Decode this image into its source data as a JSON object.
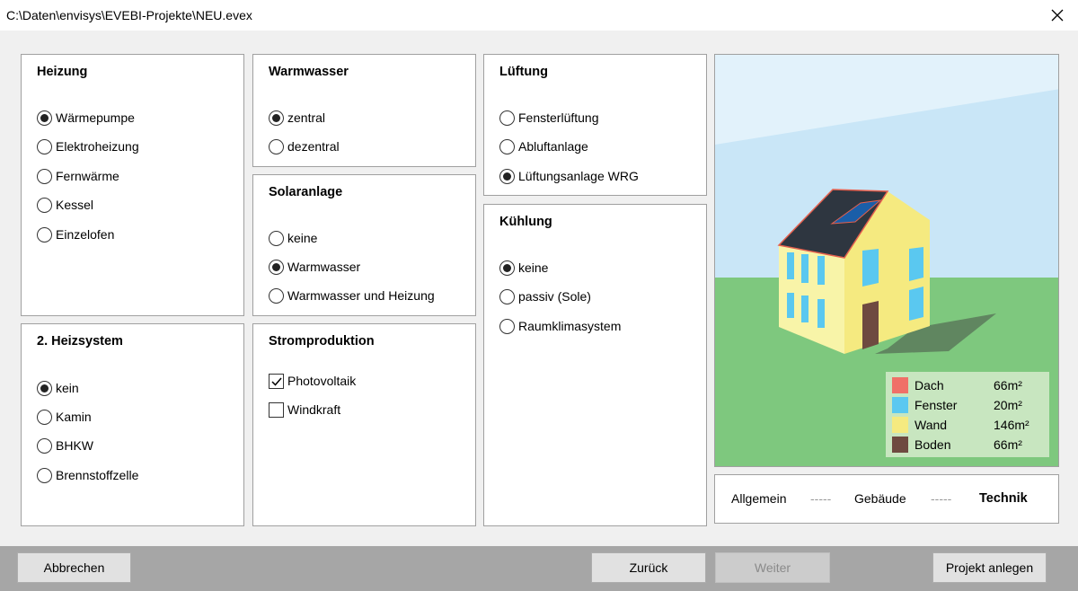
{
  "window": {
    "title": "C:\\Daten\\envisys\\EVEBI-Projekte\\NEU.evex"
  },
  "panels": {
    "heizung": {
      "title": "Heizung",
      "options": [
        {
          "label": "Wärmepumpe",
          "selected": true
        },
        {
          "label": "Elektroheizung",
          "selected": false
        },
        {
          "label": "Fernwärme",
          "selected": false
        },
        {
          "label": "Kessel",
          "selected": false
        },
        {
          "label": "Einzelofen",
          "selected": false
        }
      ]
    },
    "heizsystem2": {
      "title": "2. Heizsystem",
      "options": [
        {
          "label": "kein",
          "selected": true
        },
        {
          "label": "Kamin",
          "selected": false
        },
        {
          "label": "BHKW",
          "selected": false
        },
        {
          "label": "Brennstoffzelle",
          "selected": false
        }
      ]
    },
    "warmwasser": {
      "title": "Warmwasser",
      "options": [
        {
          "label": "zentral",
          "selected": true
        },
        {
          "label": "dezentral",
          "selected": false
        }
      ]
    },
    "solaranlage": {
      "title": "Solaranlage",
      "options": [
        {
          "label": "keine",
          "selected": false
        },
        {
          "label": "Warmwasser",
          "selected": true
        },
        {
          "label": "Warmwasser und Heizung",
          "selected": false
        }
      ]
    },
    "stromproduktion": {
      "title": "Stromproduktion",
      "options": [
        {
          "label": "Photovoltaik",
          "checked": true
        },
        {
          "label": "Windkraft",
          "checked": false
        }
      ]
    },
    "lueftung": {
      "title": "Lüftung",
      "options": [
        {
          "label": "Fensterlüftung",
          "selected": false
        },
        {
          "label": "Abluftanlage",
          "selected": false
        },
        {
          "label": "Lüftungsanlage WRG",
          "selected": true
        }
      ]
    },
    "kuehlung": {
      "title": "Kühlung",
      "options": [
        {
          "label": "keine",
          "selected": true
        },
        {
          "label": "passiv (Sole)",
          "selected": false
        },
        {
          "label": "Raumklimasystem",
          "selected": false
        }
      ]
    }
  },
  "legend": {
    "items": [
      {
        "label": "Dach",
        "value": "66m²",
        "color": "#f07068"
      },
      {
        "label": "Fenster",
        "value": "20m²",
        "color": "#5ac8f0"
      },
      {
        "label": "Wand",
        "value": "146m²",
        "color": "#f5ea80"
      },
      {
        "label": "Boden",
        "value": "66m²",
        "color": "#6e4a40"
      }
    ]
  },
  "steps": {
    "step1": "Allgemein",
    "sep1": "-----",
    "step2": "Gebäude",
    "sep2": "-----",
    "step3": "Technik"
  },
  "buttons": {
    "cancel": "Abbrechen",
    "back": "Zurück",
    "next": "Weiter",
    "create": "Projekt anlegen"
  },
  "icons": {
    "close": "close-icon",
    "house": "house-illustration"
  },
  "colors": {
    "sky": "#c9e6f7",
    "ground": "#7ec87e",
    "footer": "#a6a6a6",
    "roof": "#2e3640",
    "solar_panel": "#1a5ea8"
  }
}
